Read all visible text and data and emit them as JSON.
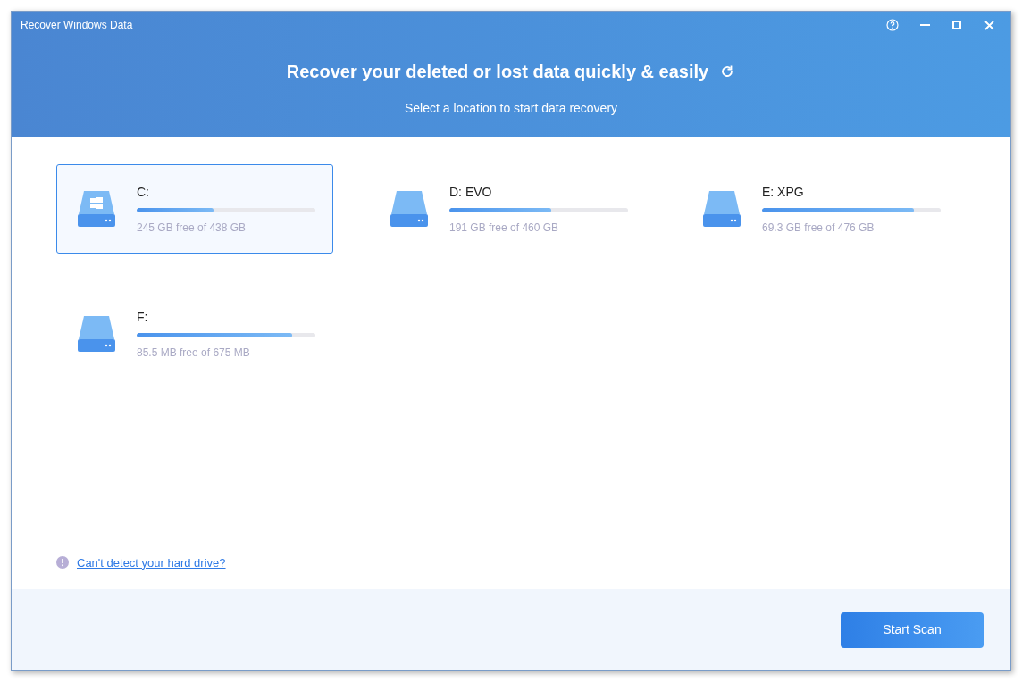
{
  "window": {
    "title": "Recover Windows Data"
  },
  "header": {
    "title": "Recover your deleted or lost data quickly & easily",
    "subtitle": "Select a location to start data recovery"
  },
  "drives": [
    {
      "name": "C:",
      "kind": "system",
      "selected": true,
      "level": 0.43,
      "usage": "245 GB free of 438 GB"
    },
    {
      "name": "D: EVO",
      "kind": "data",
      "selected": false,
      "level": 0.57,
      "usage": "191 GB free of 460 GB"
    },
    {
      "name": "E: XPG",
      "kind": "data",
      "selected": false,
      "level": 0.85,
      "usage": "69.3 GB free of 476 GB"
    },
    {
      "name": "F:",
      "kind": "data",
      "selected": false,
      "level": 0.87,
      "usage": "85.5 MB free of 675 MB"
    }
  ],
  "help_link": "Can't detect your hard drive?",
  "buttons": [
    "Start Scan"
  ]
}
